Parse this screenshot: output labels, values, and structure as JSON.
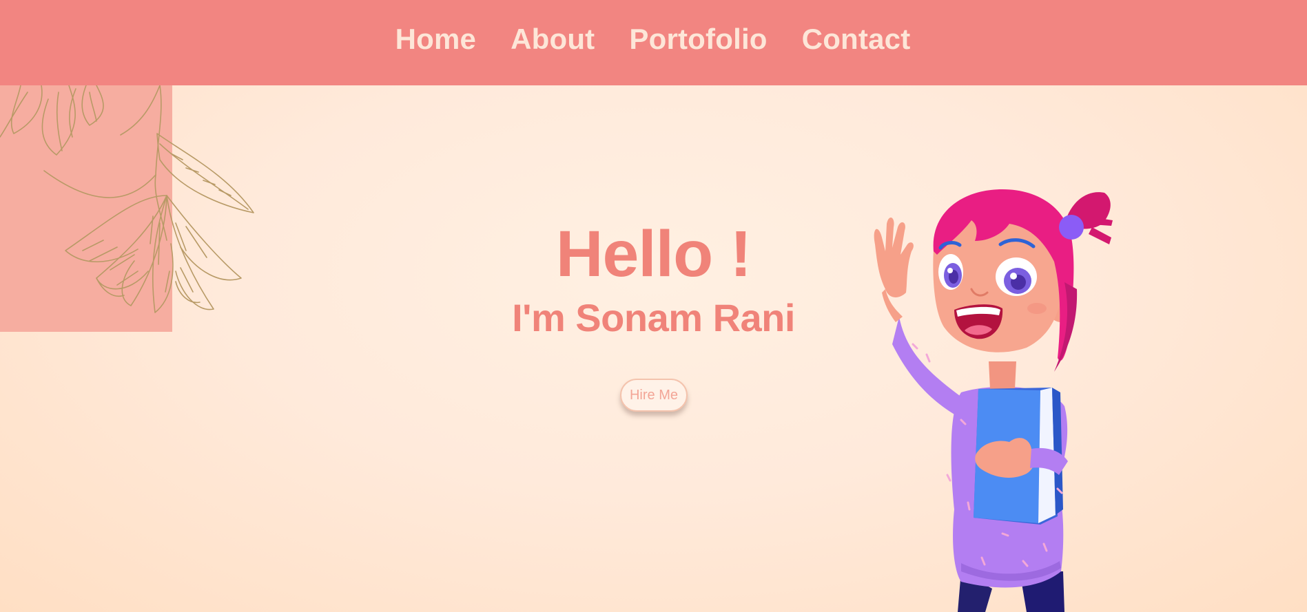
{
  "nav": {
    "items": [
      {
        "label": "Home"
      },
      {
        "label": "About"
      },
      {
        "label": "Portofolio"
      },
      {
        "label": "Contact"
      }
    ]
  },
  "hero": {
    "title": "Hello !",
    "subtitle": "I'm Sonam Rani",
    "cta_label": "Hire Me"
  },
  "colors": {
    "navbar": "#f28581",
    "nav_text": "#fde6d8",
    "heading": "#f08379",
    "deco_block": "#f6ada0",
    "background": "#ffeadb",
    "button_bg": "#fff2e8",
    "button_text": "#f3a596"
  },
  "illustrations": {
    "floral": "floral-line-art",
    "character": "waving-girl-with-book"
  }
}
